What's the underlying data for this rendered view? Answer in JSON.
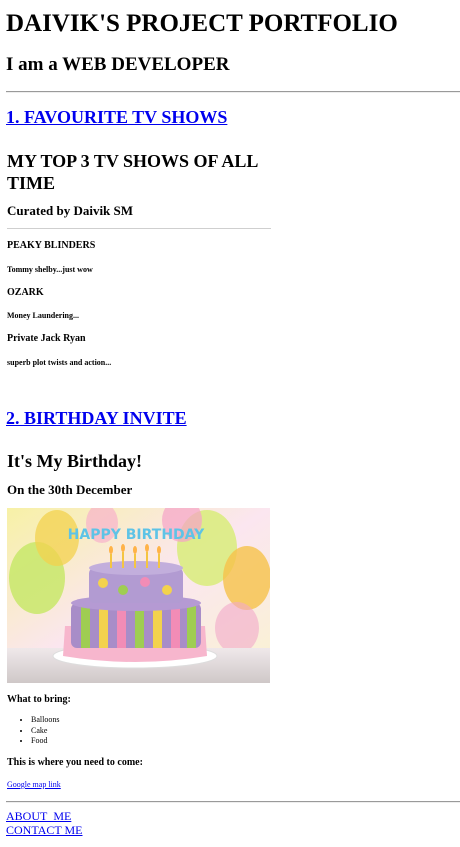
{
  "header": {
    "title": "DAIVIK'S PROJECT PORTFOLIO",
    "subtitle": "I am a WEB DEVELOPER"
  },
  "tv_section": {
    "link_label": "1. FAVOURITE TV SHOWS",
    "heading": "MY TOP 3 TV SHOWS OF ALL TIME",
    "curated": "Curated by Daivik SM",
    "shows": [
      {
        "name": "PEAKY BLINDERS",
        "note": "Tommy shelby...just wow"
      },
      {
        "name": "OZARK",
        "note": "Money Laundering..."
      },
      {
        "name": "Private Jack Ryan",
        "note": "superb plot twists and action..."
      }
    ]
  },
  "birthday_section": {
    "link_label": "2. BIRTHDAY INVITE",
    "heading": "It's My Birthday!",
    "date": "On the 30th December",
    "cake_topper": "HAPPY BIRTHDAY",
    "bring_heading": "What to bring:",
    "bring_items": [
      "Balloons",
      "Cake",
      "Food"
    ],
    "location_heading": "This is where you need to come:",
    "map_link": "Google map link"
  },
  "footer": {
    "about": "ABOUT_ME",
    "contact": "CONTACT ME"
  }
}
